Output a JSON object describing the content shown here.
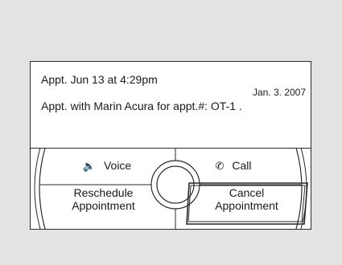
{
  "message": {
    "time_line": "Appt. Jun  13 at  4:29pm",
    "date": "Jan. 3. 2007",
    "detail": "Appt. with Marin Acura for appt.#: OT-1 ."
  },
  "controls": {
    "voice": {
      "label": "Voice",
      "icon": "speaker-icon"
    },
    "call": {
      "label": "Call",
      "icon": "phone-icon"
    },
    "reschedule": {
      "line1": "Reschedule",
      "line2": "Appointment"
    },
    "cancel": {
      "line1": "Cancel",
      "line2": "Appointment"
    }
  }
}
